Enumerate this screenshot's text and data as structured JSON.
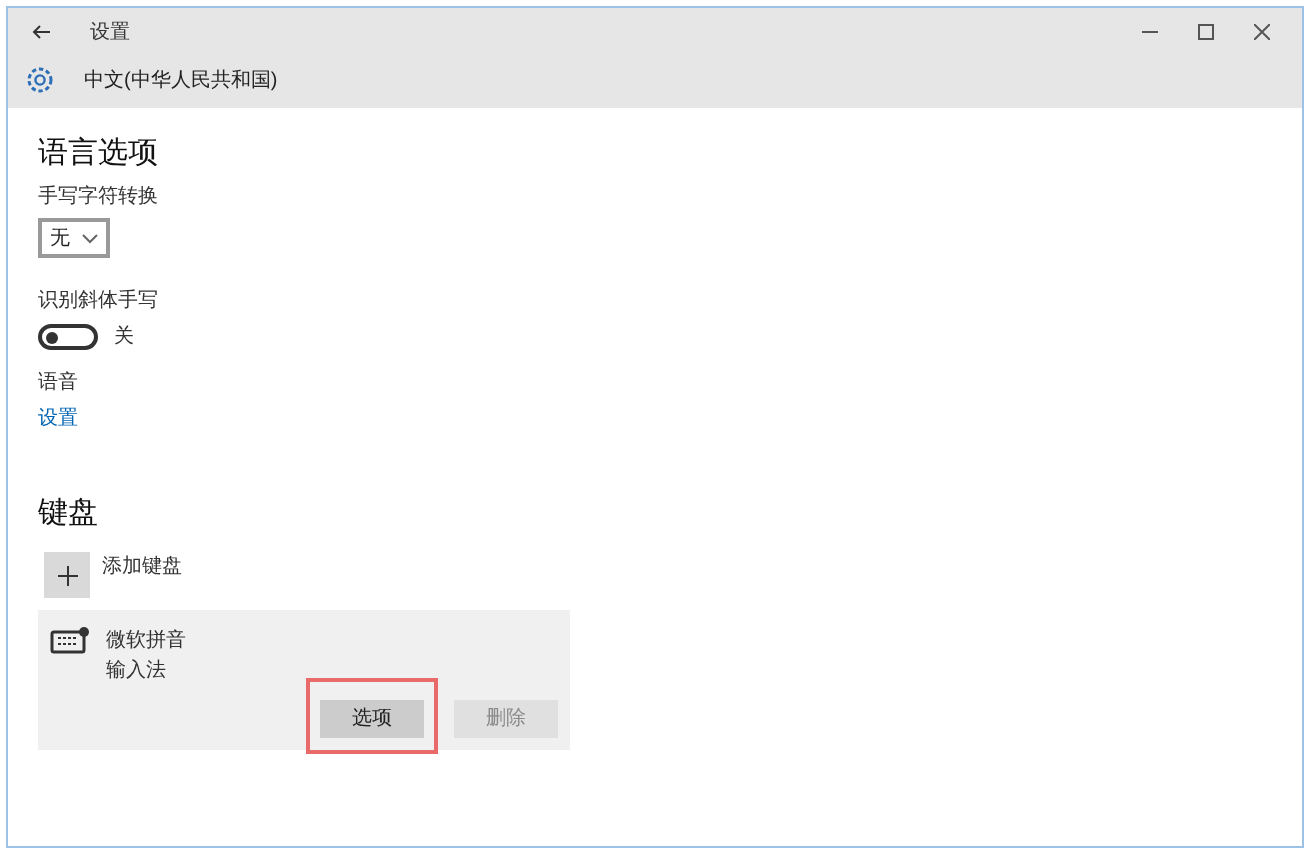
{
  "window": {
    "title": "设置",
    "page_title": "中文(中华人民共和国)"
  },
  "language_options": {
    "heading": "语言选项",
    "handwriting_conversion": {
      "label": "手写字符转换",
      "value": "无"
    },
    "cursive": {
      "label": "识别斜体手写",
      "on": false,
      "state_text": "关"
    },
    "speech": {
      "label": "语音",
      "link": "设置"
    }
  },
  "keyboard": {
    "heading": "键盘",
    "add_label": "添加键盘",
    "items": [
      {
        "name": "微软拼音",
        "subtitle": "输入法",
        "selected": true,
        "buttons": [
          {
            "label": "选项",
            "disabled": false,
            "highlighted": true
          },
          {
            "label": "删除",
            "disabled": true,
            "highlighted": false
          }
        ]
      }
    ]
  }
}
